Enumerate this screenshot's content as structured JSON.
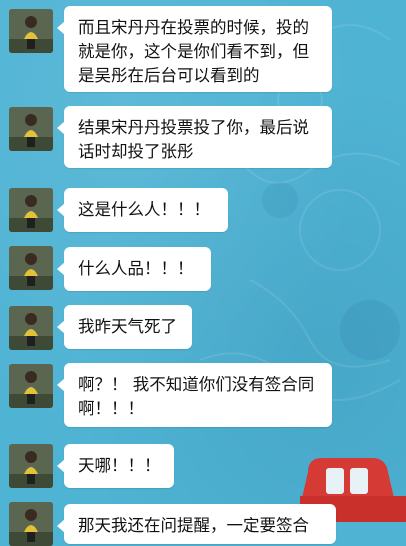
{
  "chat": {
    "background_color": "#4fb3d4",
    "bubble_color": "#ffffff",
    "messages": [
      {
        "text": "而且宋丹丹在投票的时候，投的就是你，这个是你们看不到，但是吴彤在后台可以看到的"
      },
      {
        "text": "结果宋丹丹投票投了你，最后说话时却投了张彤"
      },
      {
        "text": "这是什么人！！！"
      },
      {
        "text": "什么人品！！！"
      },
      {
        "text": "我昨天气死了"
      },
      {
        "text": "啊？！ 我不知道你们没有签合同啊！！！"
      },
      {
        "text": "天哪！！！"
      },
      {
        "text": "那天我还在问提醒，一定要签合"
      }
    ]
  }
}
